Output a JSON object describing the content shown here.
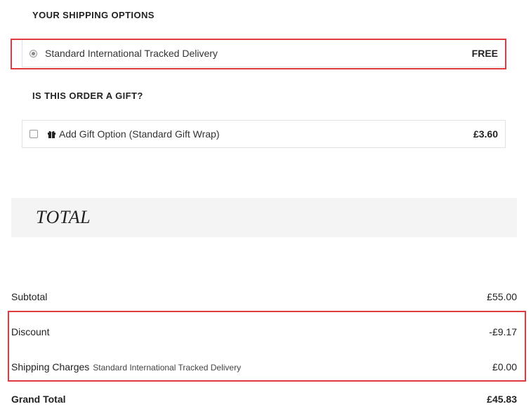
{
  "shipping": {
    "heading": "YOUR SHIPPING OPTIONS",
    "option_label": "Standard International Tracked Delivery",
    "option_price": "FREE",
    "selected": true
  },
  "gift": {
    "heading": "IS THIS ORDER A GIFT?",
    "option_label": "Add Gift Option (Standard Gift Wrap)",
    "option_price": "£3.60",
    "checked": false
  },
  "total": {
    "title": "TOTAL",
    "subtotal_label": "Subtotal",
    "subtotal_value": "£55.00",
    "discount_label": "Discount",
    "discount_value": "-£9.17",
    "shipping_label": "Shipping Charges",
    "shipping_note": "Standard International Tracked Delivery",
    "shipping_value": "£0.00",
    "grand_label": "Grand Total",
    "grand_value": "£45.83"
  },
  "colors": {
    "highlight": "#e0393e",
    "banner_bg": "#f4f4f4"
  }
}
